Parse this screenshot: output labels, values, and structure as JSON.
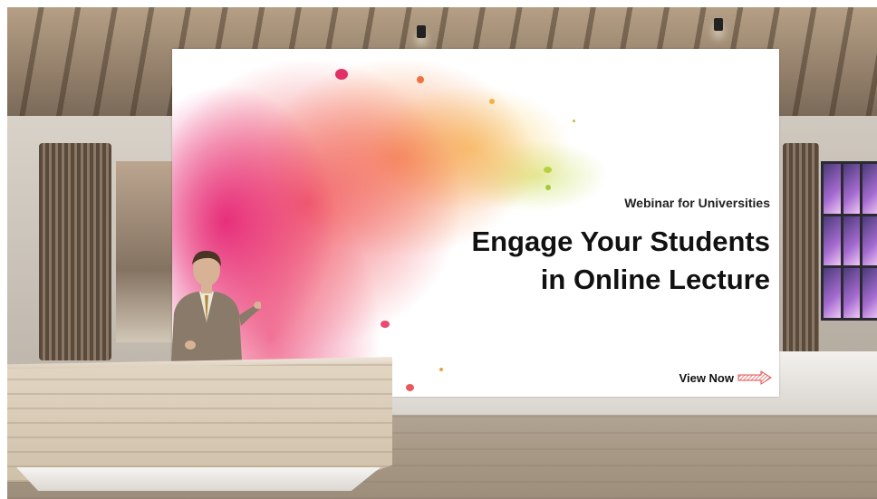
{
  "screen": {
    "subtitle": "Webinar for Universities",
    "title_line1": "Engage Your Students",
    "title_line2": "in Online Lecture",
    "cta_label": "View Now"
  },
  "colors": {
    "splash_primary": "#e6287a",
    "splash_secondary": "#f5823c",
    "splash_accent": "#c8dc50",
    "cta_arrow": "#e05050",
    "text": "#111111"
  },
  "icons": {
    "cta": "arrow-right-icon"
  }
}
